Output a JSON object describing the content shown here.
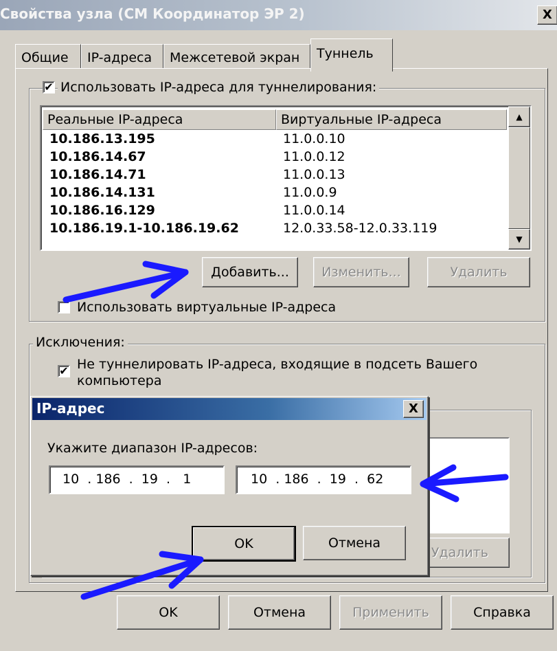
{
  "window": {
    "title": "Свойства узла (СМ Координатор ЭР 2)",
    "close_label": "X"
  },
  "tabs": [
    {
      "label": "Общие"
    },
    {
      "label": "IP-адреса"
    },
    {
      "label": "Межсетевой экран"
    },
    {
      "label": "Туннель"
    }
  ],
  "tunnel": {
    "use_ip_checkbox": {
      "label": "Использовать IP-адреса для туннелирования:",
      "checked": "✔"
    },
    "list": {
      "headers": {
        "real": "Реальные IP-адреса",
        "virtual": "Виртуальные IP-адреса"
      },
      "rows": [
        {
          "real": "10.186.13.195",
          "virtual": "11.0.0.10"
        },
        {
          "real": "10.186.14.67",
          "virtual": "11.0.0.12"
        },
        {
          "real": "10.186.14.71",
          "virtual": "11.0.0.13"
        },
        {
          "real": "10.186.14.131",
          "virtual": "11.0.0.9"
        },
        {
          "real": "10.186.16.129",
          "virtual": "11.0.0.14"
        },
        {
          "real": "10.186.19.1-10.186.19.62",
          "virtual": "12.0.33.58-12.0.33.119"
        }
      ]
    },
    "buttons": {
      "add": "Добавить...",
      "edit": "Изменить...",
      "delete": "Удалить"
    },
    "use_virtual_checkbox": {
      "label": "Использовать виртуальные IP-адреса",
      "checked": ""
    }
  },
  "exceptions": {
    "legend": "Исключения:",
    "no_tunnel_checkbox": {
      "label_line1": "Не туннелировать IP-адреса, входящие в подсеть Вашего",
      "label_line2": "компьютера",
      "checked": "✔"
    },
    "delete_button": "Удалить"
  },
  "ip_dialog": {
    "title": "IP-адрес",
    "close_label": "X",
    "prompt": "Укажите диапазон IP-адресов:",
    "from": "10  . 186  .  19  .   1",
    "to": "10  . 186  .  19  .  62",
    "ok": "OK",
    "cancel": "Отмена"
  },
  "footer": {
    "ok": "OK",
    "cancel": "Отмена",
    "apply": "Применить",
    "help": "Справка"
  },
  "colors": {
    "annotation_arrow": "#1a1aff",
    "subdialog_title": "#0a246a"
  },
  "icons": {
    "scroll_up": "scroll-up-arrow-icon",
    "scroll_down": "scroll-down-arrow-icon"
  }
}
